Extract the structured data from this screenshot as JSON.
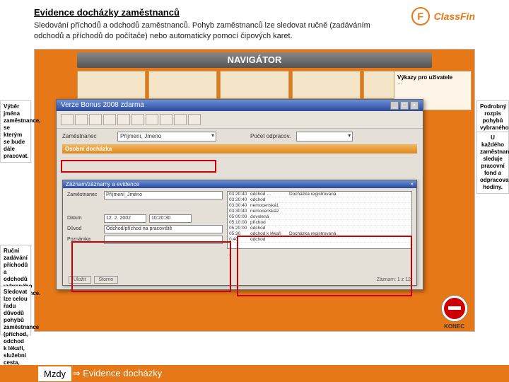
{
  "header": {
    "title": "Evidence docházky zaměstnanců",
    "subtitle": "Sledování příchodů a odchodů zaměstnanců. Pohyb zaměstnanců lze sledovat ručně (zadáváním odchodů a příchodů do počítače) nebo automaticky pomocí čipových karet.",
    "brand": "ClassFin",
    "brand_letter": "F"
  },
  "navigator": {
    "title": "NAVIGÁTOR"
  },
  "side_panel": {
    "title": "Výkazy pro uživatele",
    "lines": [
      "…"
    ]
  },
  "subwindow": {
    "title": "Verze Bonus 2008 zdarma",
    "fields": {
      "employee_label": "Zaměstnanec",
      "employee_value": "Příjmení, Jmeno",
      "period_label": "Počet odpracov."
    },
    "group1": "Osobní docházka",
    "inner": {
      "title": "Záznam/záznamy a evidence",
      "employee_label": "Zaměstnanec",
      "employee_value": "Příjmení_Jméno",
      "date_label": "Datum",
      "date_value": "12. 2. 2002",
      "time_value": "10:20:30",
      "reason_label": "Důvod",
      "reason_value": "Odchod/příchod na pracoviště",
      "note_label": "Poznámka",
      "rows": [
        [
          "03:20:40",
          "odchod …",
          "Docházka registrovaná"
        ],
        [
          "03:20:40",
          "odchod",
          "  "
        ],
        [
          "03:30:40",
          "nemocenská1",
          "  "
        ],
        [
          "03:30:40",
          "nemocenská2",
          "  "
        ],
        [
          "05:00:00",
          "dovolená",
          "  "
        ],
        [
          "05:10:00",
          "příchod",
          "  "
        ],
        [
          "05:20:00",
          "odchod",
          "  "
        ],
        [
          "05:30",
          "odchod k lékaři",
          "Docházka registrovaná"
        ],
        [
          "0:40",
          "odchod",
          "  "
        ]
      ],
      "buttons": {
        "ok": "Uložit",
        "cancel": "Storno"
      },
      "status": "Záznam: 1 z 12"
    }
  },
  "konec": "KONEC",
  "callouts": {
    "c1": "Výběr jména zaměstnance, se kterým se bude dále pracovat.",
    "c2": "Ruční zadávání příchodů a odchodů vybraného zaměstnance.",
    "c3": "Sledovat lze celou řadu důvodů pohybů zaměstnance (příchod, odchod k lékaři, služební cesta, atd.).",
    "c4": "Podrobný rozpis pohybů vybraného zaměstnance.",
    "c5": "U každého zaměstnance sleduje pracovní fond a odpracované hodiny."
  },
  "footer": {
    "pre": "Mzdy",
    "arrow": "⇒",
    "rest": "Evidence docházky"
  }
}
